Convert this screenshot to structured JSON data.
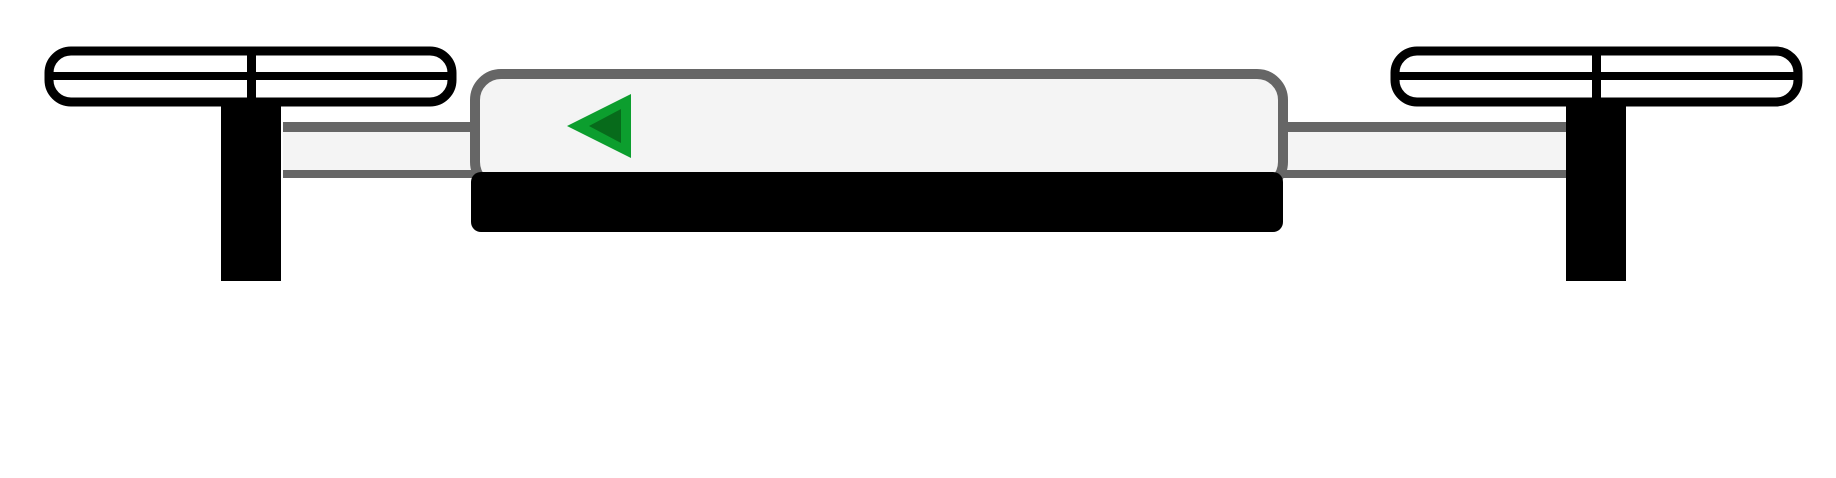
{
  "palette": {
    "background": "#ffffff",
    "outline": "#666666",
    "body_fill": "#f4f4f4",
    "ink": "#000000",
    "arrow_outer": "#0c9e2e",
    "arrow_inner": "#076b1b"
  },
  "icons": {
    "left_rotor": "propeller-icon",
    "right_rotor": "propeller-icon",
    "direction": "left-arrow-icon"
  },
  "state": {
    "direction": "left"
  }
}
